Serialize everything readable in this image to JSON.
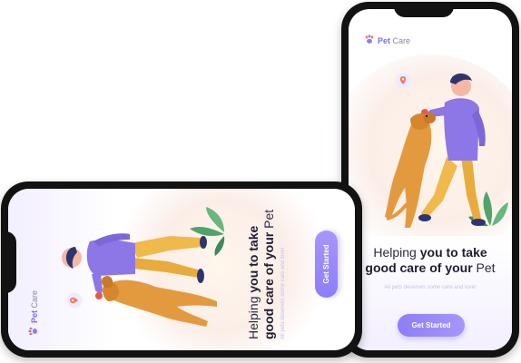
{
  "app": {
    "brand_bold": "Pet",
    "brand_rest": "Care"
  },
  "hero": {
    "headline_line1_a": "Helping ",
    "headline_line1_b": "you to take",
    "headline_line2_a": "good care of your ",
    "headline_line2_b": "Pet",
    "subtext": "All pets deserves some care and love!"
  },
  "cta": {
    "label": "Get Started"
  },
  "colors": {
    "accent": "#8c7ef8",
    "accent_light": "#f0ecff",
    "dog": "#e39a3f",
    "shirt": "#8d76e6",
    "pants": "#f0b94b",
    "hair": "#2d3470",
    "plant": "#4fa36b"
  },
  "icons": {
    "brand": "paw-icon",
    "pin": "location-pin-icon",
    "plant": "plant-icon"
  }
}
